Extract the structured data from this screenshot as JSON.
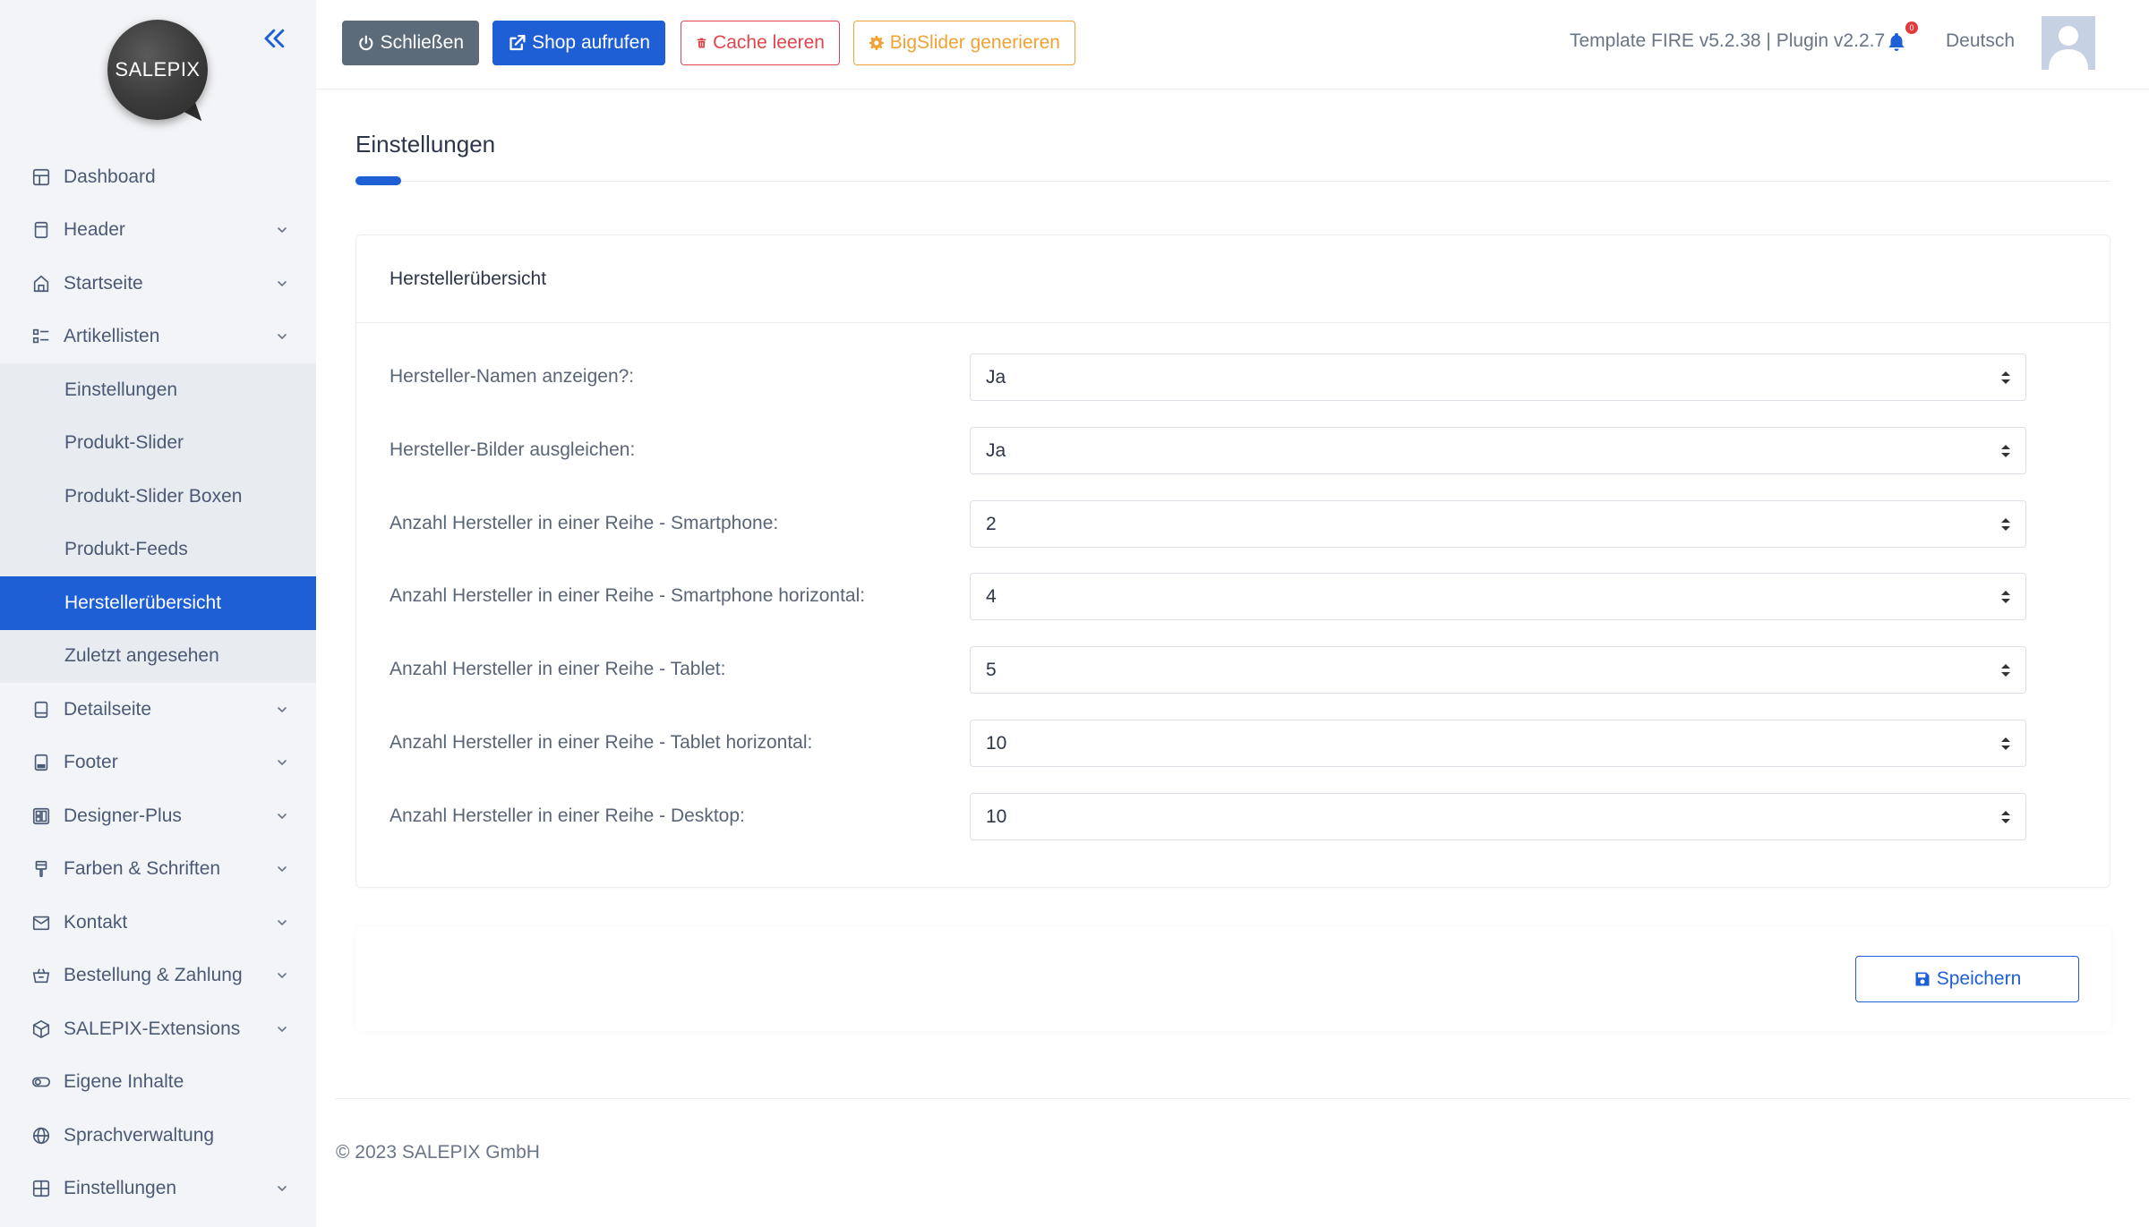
{
  "brand": {
    "logo_text": "SALEPIX"
  },
  "sidebar": {
    "items": [
      {
        "label": "Dashboard",
        "icon": "dashboard-icon",
        "has_submenu": false
      },
      {
        "label": "Header",
        "icon": "header-icon",
        "has_submenu": true
      },
      {
        "label": "Startseite",
        "icon": "home-icon",
        "has_submenu": true
      },
      {
        "label": "Artikellisten",
        "icon": "list-icon",
        "has_submenu": true,
        "expanded": true
      },
      {
        "label": "Detailseite",
        "icon": "detail-page-icon",
        "has_submenu": true
      },
      {
        "label": "Footer",
        "icon": "footer-icon",
        "has_submenu": true
      },
      {
        "label": "Designer-Plus",
        "icon": "designer-icon",
        "has_submenu": true
      },
      {
        "label": "Farben & Schriften",
        "icon": "brush-icon",
        "has_submenu": true
      },
      {
        "label": "Kontakt",
        "icon": "mail-icon",
        "has_submenu": true
      },
      {
        "label": "Bestellung & Zahlung",
        "icon": "basket-icon",
        "has_submenu": true
      },
      {
        "label": "SALEPIX-Extensions",
        "icon": "box-icon",
        "has_submenu": true
      },
      {
        "label": "Eigene Inhalte",
        "icon": "toggle-icon",
        "has_submenu": false
      },
      {
        "label": "Sprachverwaltung",
        "icon": "globe-icon",
        "has_submenu": false
      },
      {
        "label": "Einstellungen",
        "icon": "settings-grid-icon",
        "has_submenu": true
      }
    ],
    "submenu": [
      {
        "label": "Einstellungen",
        "active": false
      },
      {
        "label": "Produkt-Slider",
        "active": false
      },
      {
        "label": "Produkt-Slider Boxen",
        "active": false
      },
      {
        "label": "Produkt-Feeds",
        "active": false
      },
      {
        "label": "Herstellerübersicht",
        "active": true
      },
      {
        "label": "Zuletzt angesehen",
        "active": false
      }
    ]
  },
  "toolbar": {
    "close_label": "Schließen",
    "shop_label": "Shop aufrufen",
    "cache_label": "Cache leeren",
    "slider_label": "BigSlider generieren",
    "version": "Template FIRE v5.2.38 | Plugin v2.2.7",
    "notification_count": "0",
    "language": "Deutsch"
  },
  "page": {
    "title": "Einstellungen",
    "card_title": "Herstellerübersicht",
    "fields": [
      {
        "label": "Hersteller-Namen anzeigen?:",
        "value": "Ja"
      },
      {
        "label": "Hersteller-Bilder ausgleichen:",
        "value": "Ja"
      },
      {
        "label": "Anzahl Hersteller in einer Reihe - Smartphone:",
        "value": "2"
      },
      {
        "label": "Anzahl Hersteller in einer Reihe - Smartphone horizontal:",
        "value": "4"
      },
      {
        "label": "Anzahl Hersteller in einer Reihe - Tablet:",
        "value": "5"
      },
      {
        "label": "Anzahl Hersteller in einer Reihe - Tablet horizontal:",
        "value": "10"
      },
      {
        "label": "Anzahl Hersteller in einer Reihe - Desktop:",
        "value": "10"
      }
    ],
    "save_label": "Speichern"
  },
  "footer": {
    "copyright": "© 2023 SALEPIX GmbH"
  },
  "colors": {
    "primary": "#1f5fd6",
    "danger": "#e0454c",
    "warning": "#f0a235",
    "secondary": "#5c6b7a",
    "sidebar_bg": "#f3f4f7"
  }
}
